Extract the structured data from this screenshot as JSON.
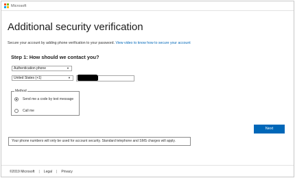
{
  "header": {
    "logo_text": "Microsoft",
    "logo_colors": [
      "#f25022",
      "#7fba00",
      "#00a4ef",
      "#ffb900"
    ]
  },
  "page": {
    "title": "Additional security verification",
    "intro_text": "Secure your account by adding phone verification to your password. ",
    "intro_link": "View video to know how to secure your account"
  },
  "step": {
    "heading": "Step 1: How should we contact you?",
    "contact_method_select": "Authentication phone",
    "country_select": "United States (+1)",
    "phone_value": ""
  },
  "method": {
    "legend": "Method",
    "options": [
      {
        "label": "Send me a code by text message",
        "selected": true
      },
      {
        "label": "Call me",
        "selected": false
      }
    ]
  },
  "actions": {
    "next_label": "Next",
    "accent_color": "#0067b8"
  },
  "notice": {
    "text": "Your phone numbers will only be used for account security. Standard telephone and SMS charges will apply."
  },
  "footer": {
    "copyright": "©2019 Microsoft",
    "legal": "Legal",
    "privacy": "Privacy"
  }
}
